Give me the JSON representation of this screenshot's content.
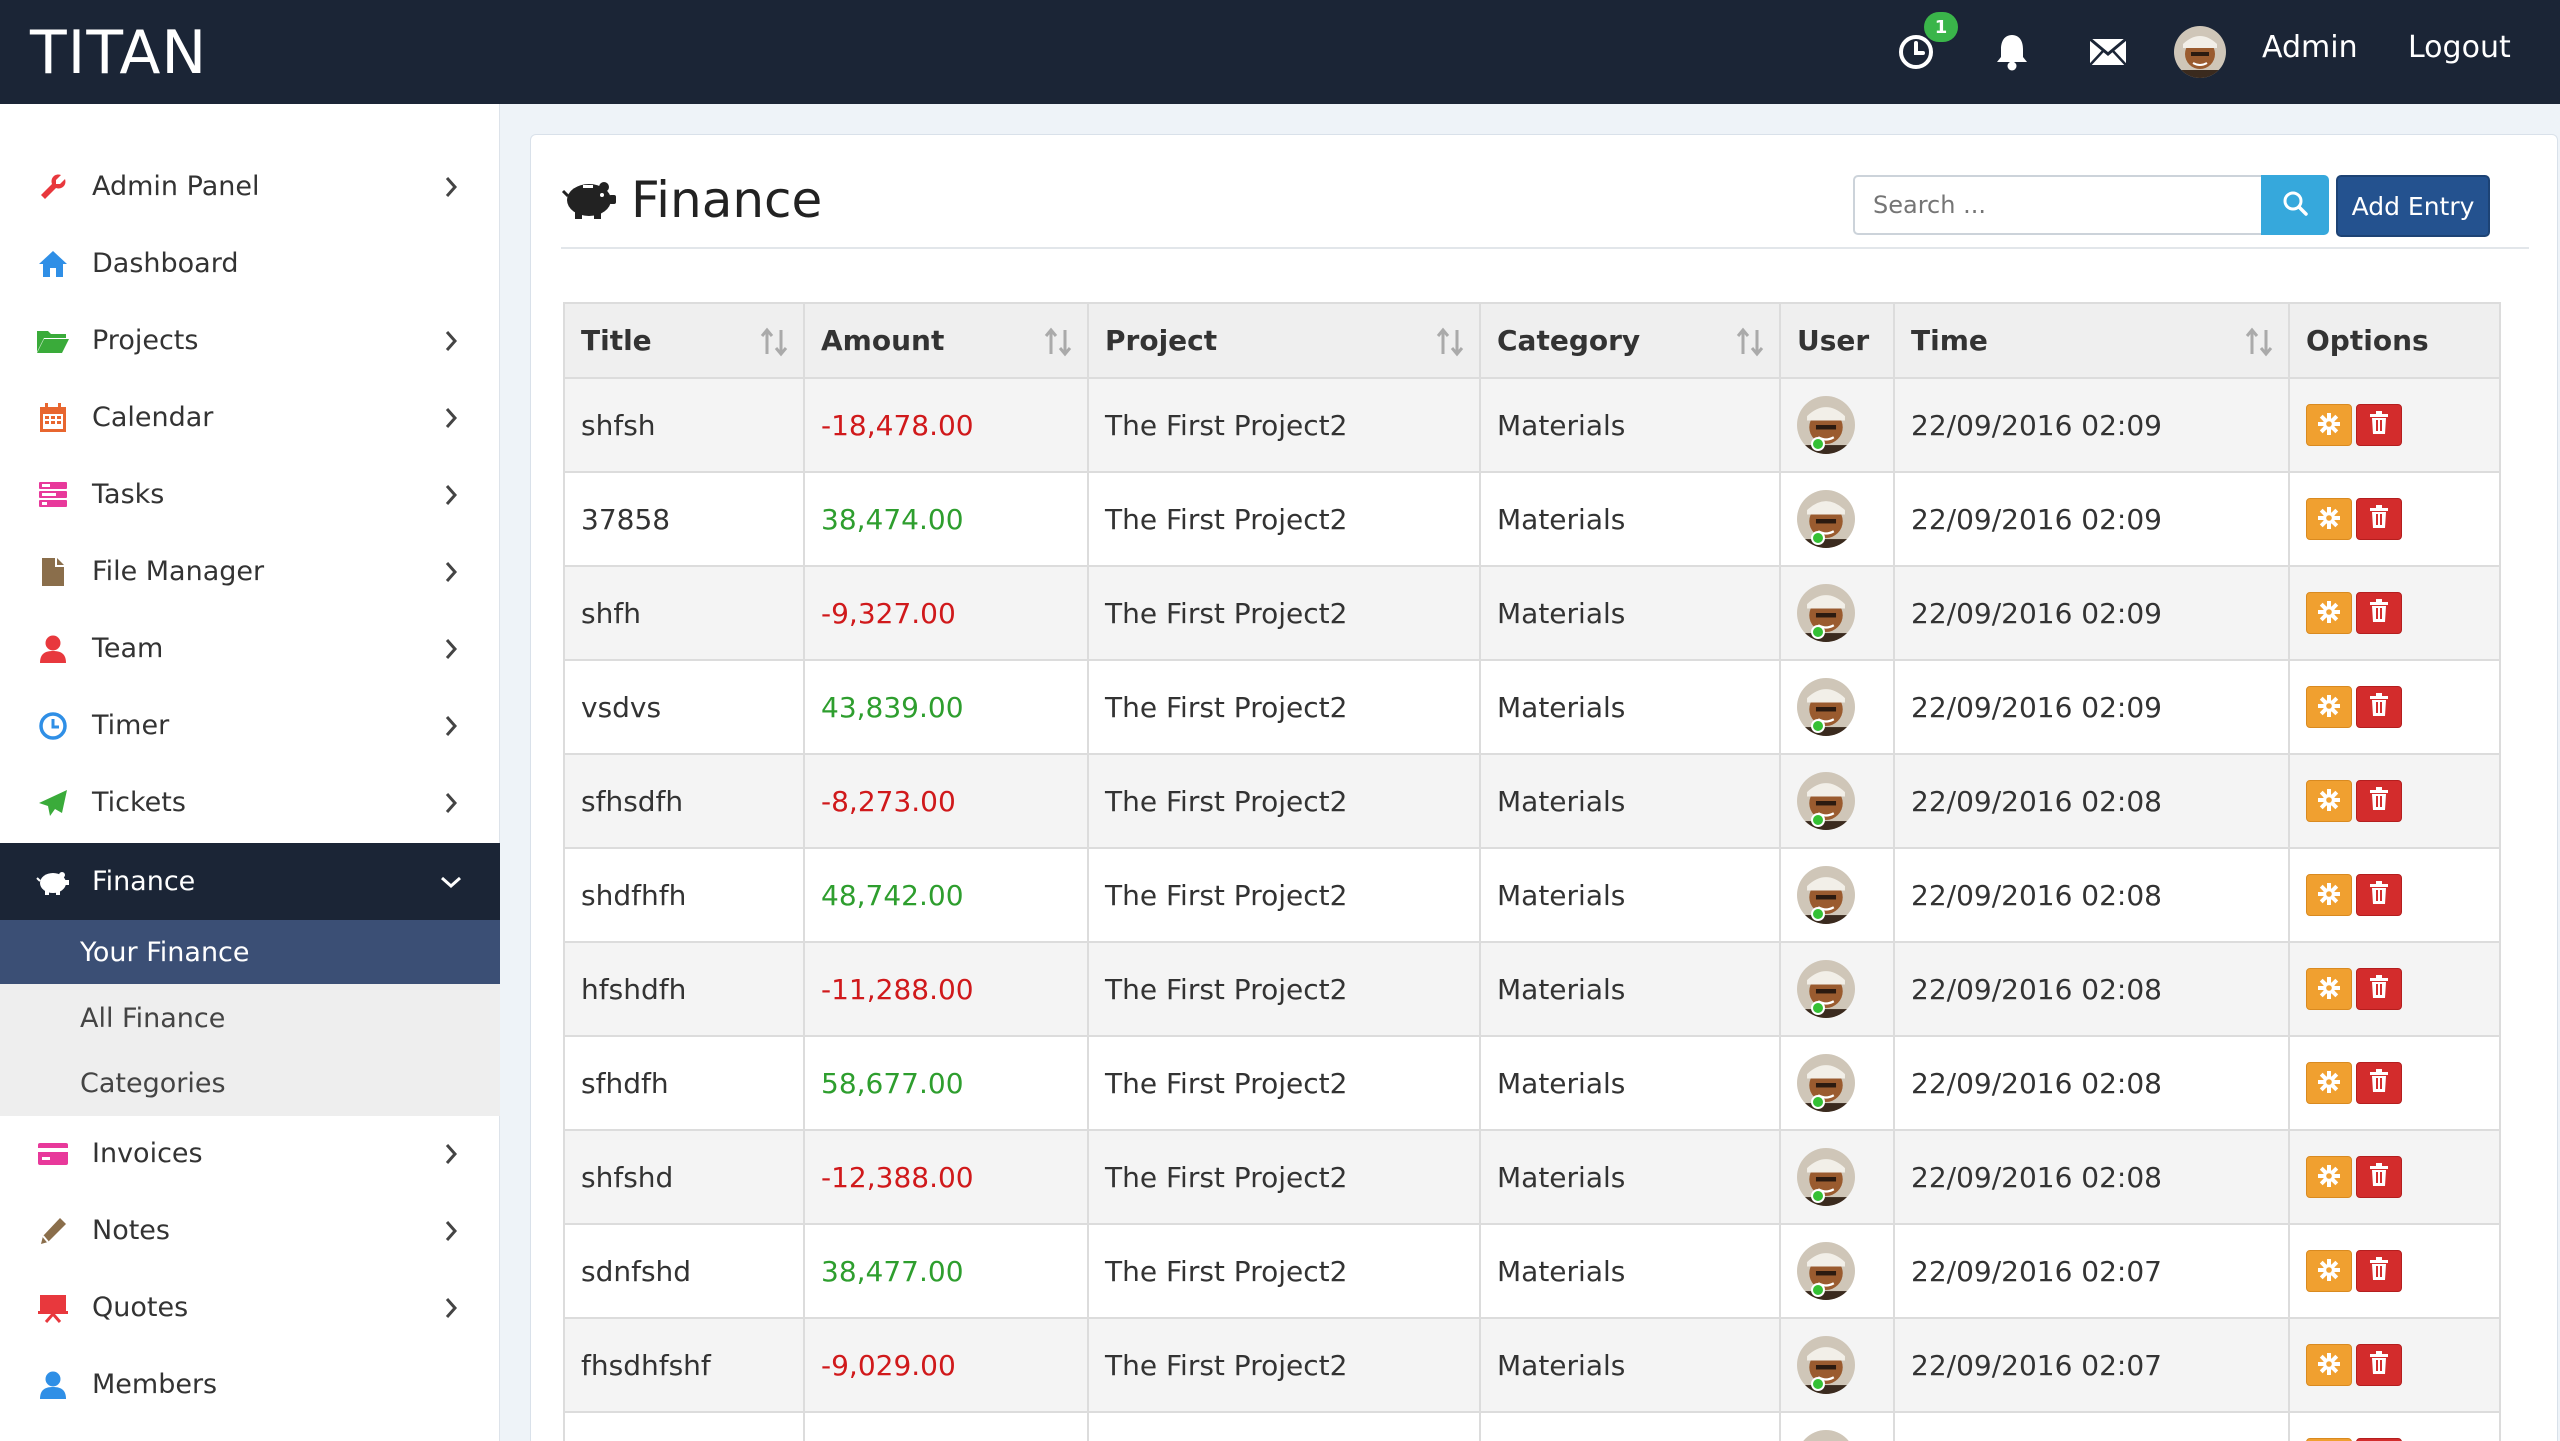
{
  "app": {
    "brand": "TITAN"
  },
  "topbar": {
    "timer_badge": "1",
    "user_label": "Admin",
    "logout_label": "Logout",
    "icons": [
      "clock-icon",
      "bell-icon",
      "envelope-icon",
      "user-avatar"
    ]
  },
  "sidebar": {
    "items": [
      {
        "label": "Admin Panel",
        "icon": "wrench-icon",
        "color": "#e8383d",
        "chevron": true
      },
      {
        "label": "Dashboard",
        "icon": "home-icon",
        "color": "#2f8fe6",
        "chevron": false
      },
      {
        "label": "Projects",
        "icon": "folder-icon",
        "color": "#3aab3a",
        "chevron": true
      },
      {
        "label": "Calendar",
        "icon": "calendar-icon",
        "color": "#e8662f",
        "chevron": true
      },
      {
        "label": "Tasks",
        "icon": "tasks-icon",
        "color": "#e8399b",
        "chevron": true
      },
      {
        "label": "File Manager",
        "icon": "file-icon",
        "color": "#8a6e4b",
        "chevron": true
      },
      {
        "label": "Team",
        "icon": "user-icon",
        "color": "#e8383d",
        "chevron": true
      },
      {
        "label": "Timer",
        "icon": "clock-icon",
        "color": "#2f8fe6",
        "chevron": true
      },
      {
        "label": "Tickets",
        "icon": "paper-plane-icon",
        "color": "#3aab3a",
        "chevron": true
      },
      {
        "label": "Finance",
        "icon": "piggy-bank-icon",
        "color": "#ffffff",
        "chevron": true,
        "active": true
      },
      {
        "label": "Invoices",
        "icon": "credit-card-icon",
        "color": "#e8399b",
        "chevron": true
      },
      {
        "label": "Notes",
        "icon": "pencil-icon",
        "color": "#8a6e4b",
        "chevron": true
      },
      {
        "label": "Quotes",
        "icon": "presentation-icon",
        "color": "#e8383d",
        "chevron": true
      },
      {
        "label": "Members",
        "icon": "user-icon",
        "color": "#2f8fe6",
        "chevron": false
      }
    ],
    "finance_sub": [
      {
        "label": "Your Finance",
        "active": true
      },
      {
        "label": "All Finance"
      },
      {
        "label": "Categories"
      }
    ]
  },
  "main": {
    "title": "Finance",
    "search_placeholder": "Search ...",
    "add_label": "Add Entry",
    "columns": [
      "Title",
      "Amount",
      "Project",
      "Category",
      "User",
      "Time",
      "Options"
    ],
    "rows": [
      {
        "title": "shfsh",
        "amount": "-18,478.00",
        "sign": "neg",
        "project": "The First Project2",
        "category": "Materials",
        "time": "22/09/2016 02:09"
      },
      {
        "title": "37858",
        "amount": "38,474.00",
        "sign": "pos",
        "project": "The First Project2",
        "category": "Materials",
        "time": "22/09/2016 02:09"
      },
      {
        "title": "shfh",
        "amount": "-9,327.00",
        "sign": "neg",
        "project": "The First Project2",
        "category": "Materials",
        "time": "22/09/2016 02:09"
      },
      {
        "title": "vsdvs",
        "amount": "43,839.00",
        "sign": "pos",
        "project": "The First Project2",
        "category": "Materials",
        "time": "22/09/2016 02:09"
      },
      {
        "title": "sfhsdfh",
        "amount": "-8,273.00",
        "sign": "neg",
        "project": "The First Project2",
        "category": "Materials",
        "time": "22/09/2016 02:08"
      },
      {
        "title": "shdfhfh",
        "amount": "48,742.00",
        "sign": "pos",
        "project": "The First Project2",
        "category": "Materials",
        "time": "22/09/2016 02:08"
      },
      {
        "title": "hfshdfh",
        "amount": "-11,288.00",
        "sign": "neg",
        "project": "The First Project2",
        "category": "Materials",
        "time": "22/09/2016 02:08"
      },
      {
        "title": "sfhdfh",
        "amount": "58,677.00",
        "sign": "pos",
        "project": "The First Project2",
        "category": "Materials",
        "time": "22/09/2016 02:08"
      },
      {
        "title": "shfshd",
        "amount": "-12,388.00",
        "sign": "neg",
        "project": "The First Project2",
        "category": "Materials",
        "time": "22/09/2016 02:08"
      },
      {
        "title": "sdnfshd",
        "amount": "38,477.00",
        "sign": "pos",
        "project": "The First Project2",
        "category": "Materials",
        "time": "22/09/2016 02:07"
      },
      {
        "title": "fhsdhfshf",
        "amount": "-9,029.00",
        "sign": "neg",
        "project": "The First Project2",
        "category": "Materials",
        "time": "22/09/2016 02:07"
      },
      {
        "title": "",
        "amount": "",
        "sign": "pos",
        "project": "",
        "category": "",
        "time": ""
      }
    ]
  }
}
